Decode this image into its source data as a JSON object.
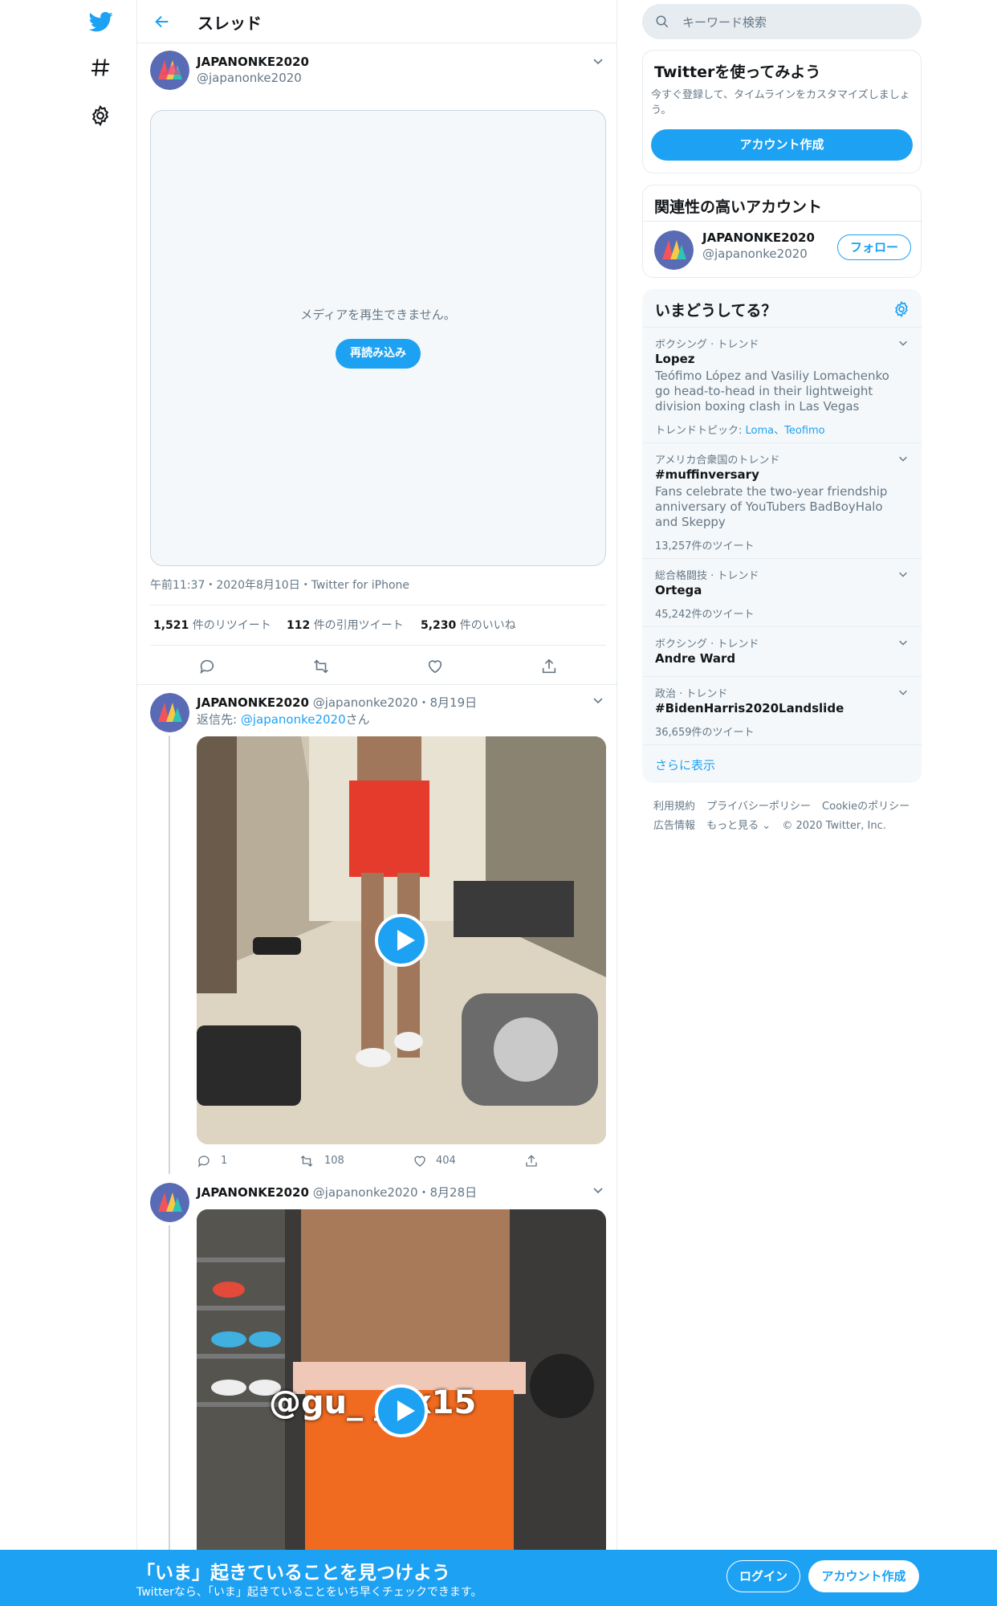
{
  "nav": {
    "icons": [
      "twitter-logo-icon",
      "hashtag-icon",
      "settings-gear-icon"
    ]
  },
  "header": {
    "title": "スレッド"
  },
  "main_tweet": {
    "name": "JAPANONKE2020",
    "handle": "@japanonke2020",
    "media_error": "メディアを再生できません。",
    "reload": "再読み込み",
    "timestamp": "午前11:37・2020年8月10日・Twitter for iPhone",
    "retweets": "1,521",
    "retweets_label": "件のリツイート",
    "quotes": "112",
    "quotes_label": "件の引用ツイート",
    "likes": "5,230",
    "likes_label": "件のいいね"
  },
  "reply1": {
    "name": "JAPANONKE2020",
    "handle": "@japanonke2020",
    "date": "・8月19日",
    "reply_prefix": "返信先: ",
    "reply_to": "@japanonke2020",
    "reply_suffix": "さん",
    "replies": "1",
    "retweets": "108",
    "likes": "404"
  },
  "reply2": {
    "name": "JAPANONKE2020",
    "handle": "@japanonke2020",
    "date": "・8月28日",
    "overlay_text": "@gu_ _xx15"
  },
  "search": {
    "placeholder": "キーワード検索"
  },
  "signup_card": {
    "title": "Twitterを使ってみよう",
    "text": "今すぐ登録して、タイムラインをカスタマイズしましょう。",
    "button": "アカウント作成"
  },
  "related": {
    "title": "関連性の高いアカウント",
    "name": "JAPANONKE2020",
    "handle": "@japanonke2020",
    "follow": "フォロー"
  },
  "trends": {
    "title": "いまどうしてる？",
    "items": [
      {
        "meta": "ボクシング · トレンド",
        "name": "Lopez",
        "desc": "Teófimo López and Vasiliy Lomachenko go head-to-head in their lightweight division boxing clash in Las Vegas",
        "topic_label": "トレンドトピック: ",
        "topic1": "Loma",
        "topic_sep": "、",
        "topic2": "Teofimo"
      },
      {
        "meta": "アメリカ合衆国のトレンド",
        "name": "#muffinversary",
        "desc": "Fans celebrate the two-year friendship anniversary of YouTubers BadBoyHalo and Skeppy",
        "count": "13,257件のツイート"
      },
      {
        "meta": "総合格闘技 · トレンド",
        "name": "Ortega",
        "count": "45,242件のツイート"
      },
      {
        "meta": "ボクシング · トレンド",
        "name": "Andre Ward"
      },
      {
        "meta": "政治 · トレンド",
        "name": "#BidenHarris2020Landslide",
        "count": "36,659件のツイート"
      }
    ],
    "more": "さらに表示"
  },
  "footer": {
    "links": [
      "利用規約",
      "プライバシーポリシー",
      "Cookieのポリシー",
      "広告情報",
      "もっと見る ⌄",
      "© 2020 Twitter, Inc."
    ]
  },
  "banner": {
    "headline": "「いま」起きていることを見つけよう",
    "sub": "Twitterなら、「いま」起きていることをいち早くチェックできます。",
    "login": "ログイン",
    "signup": "アカウント作成"
  },
  "colors": {
    "accent": "#1da1f2",
    "muted": "#657786",
    "border": "#e6ecf0"
  }
}
